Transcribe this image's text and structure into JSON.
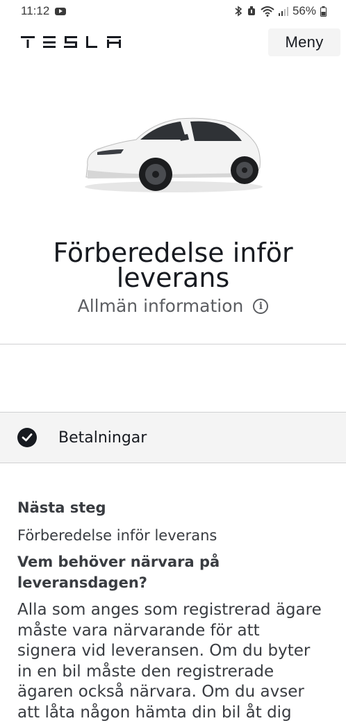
{
  "status_bar": {
    "time": "11:12",
    "battery": "56%"
  },
  "header": {
    "logo_text": "TESLA",
    "menu_label": "Meny"
  },
  "hero": {
    "title": "Förberedelse inför leverans",
    "subtitle": "Allmän information"
  },
  "payments": {
    "label": "Betalningar",
    "completed": true
  },
  "content": {
    "next_heading": "Nästa steg",
    "next_value": "Förberedelse inför leverans",
    "question_heading": "Vem behöver närvara på leveransdagen?",
    "question_body": "Alla som anges som registrerad ägare måste vara närvarande för att signera vid leveransen. Om du byter in en bil måste den registrerade ägaren också närvara. Om du avser att låta någon hämta din bil åt dig"
  },
  "colors": {
    "primary_text": "#171a20",
    "secondary_text": "#5c5e62",
    "body_text": "#393c41",
    "panel_bg": "#f4f4f4"
  }
}
